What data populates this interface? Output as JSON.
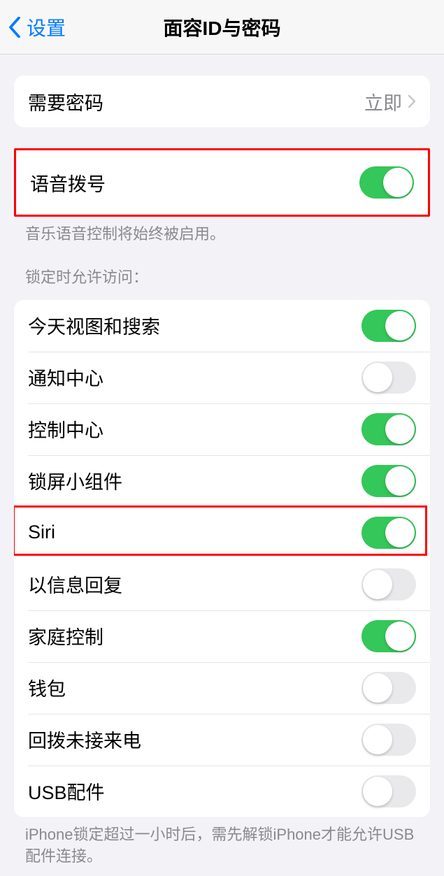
{
  "nav": {
    "back_label": "设置",
    "title": "面容ID与密码"
  },
  "require_passcode": {
    "label": "需要密码",
    "value": "立即"
  },
  "voice_dial": {
    "label": "语音拨号",
    "on": true,
    "footer": "音乐语音控制将始终被启用。"
  },
  "lock_access": {
    "header": "锁定时允许访问：",
    "items": [
      {
        "label": "今天视图和搜索",
        "on": true
      },
      {
        "label": "通知中心",
        "on": false
      },
      {
        "label": "控制中心",
        "on": true
      },
      {
        "label": "锁屏小组件",
        "on": true
      },
      {
        "label": "Siri",
        "on": true
      },
      {
        "label": "以信息回复",
        "on": false
      },
      {
        "label": "家庭控制",
        "on": true
      },
      {
        "label": "钱包",
        "on": false
      },
      {
        "label": "回拨未接来电",
        "on": false
      },
      {
        "label": "USB配件",
        "on": false
      }
    ],
    "footer": "iPhone锁定超过一小时后，需先解锁iPhone才能允许USB配件连接。"
  },
  "highlighted_indices": [
    4
  ]
}
